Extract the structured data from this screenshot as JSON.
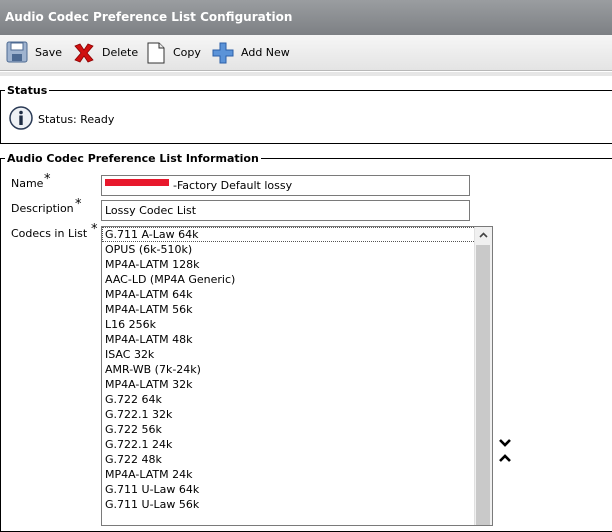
{
  "window": {
    "title": "Audio Codec Preference List Configuration"
  },
  "toolbar": {
    "save_label": "Save",
    "delete_label": "Delete",
    "copy_label": "Copy",
    "add_new_label": "Add New"
  },
  "status": {
    "legend": "Status",
    "text": "Status: Ready"
  },
  "info": {
    "legend": "Audio Codec Preference List Information",
    "name_label": "Name",
    "name_value": "-Factory Default lossy",
    "description_label": "Description",
    "description_value": "Lossy Codec List",
    "codecs_label": "Codecs in List",
    "required_mark": "*"
  },
  "codecs": [
    "G.711 A-Law 64k",
    "OPUS (6k-510k)",
    "MP4A-LATM 128k",
    "AAC-LD (MP4A Generic)",
    "MP4A-LATM 64k",
    "MP4A-LATM 56k",
    "L16 256k",
    "MP4A-LATM 48k",
    "ISAC 32k",
    "AMR-WB (7k-24k)",
    "MP4A-LATM 32k",
    "G.722 64k",
    "G.722.1 32k",
    "G.722 56k",
    "G.722.1 24k",
    "G.722 48k",
    "MP4A-LATM 24k",
    "G.711 U-Law 64k",
    "G.711 U-Law 56k"
  ],
  "colors": {
    "title_bar": "#8a8d90",
    "toolbar": "#ececec",
    "delete_red": "#d01010",
    "add_blue": "#3a78c8",
    "redaction": "#e8182c"
  }
}
